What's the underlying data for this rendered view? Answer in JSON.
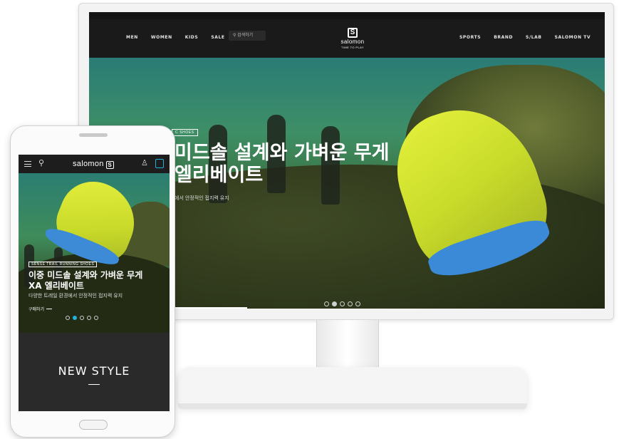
{
  "colors": {
    "accent": "#22b3d8",
    "shoe": "#d4e32f",
    "sole": "#3a8ad8"
  },
  "desktop": {
    "utility_left": "",
    "utility_right": [
      "",
      "",
      ""
    ],
    "utility_highlight": "",
    "nav_left": [
      "MEN",
      "WOMEN",
      "KIDS",
      "SALE"
    ],
    "search_placeholder": "검색하기",
    "logo_mark": "S",
    "logo_word": "salomon",
    "logo_tagline": "TIME TO PLAY",
    "nav_right": [
      "SPORTS",
      "BRAND",
      "S/LAB",
      "SALOMON TV"
    ],
    "hero": {
      "tagline": "C SHOES",
      "title_line1": "미드솔 설계와 가벼운 무게",
      "title_line2": "엘리베이트",
      "subtitle": "에서 안정적인 접지력 유지"
    },
    "slides": 5,
    "active_slide": 2
  },
  "mobile": {
    "brand": "salomon",
    "logo_mark": "S",
    "hero": {
      "tagline": "SENSE TRAIL RUNNING SHOES",
      "title_line1": "이중 미드솔 설계와 가벼운 무게",
      "title_line2": "XA 엘리베이트",
      "subtitle": "다양한 트레일 환경에서 안정적인 접지력 유지",
      "more_label": "구매하기"
    },
    "slides": 5,
    "active_slide": 2,
    "section_title": "NEW STYLE"
  }
}
